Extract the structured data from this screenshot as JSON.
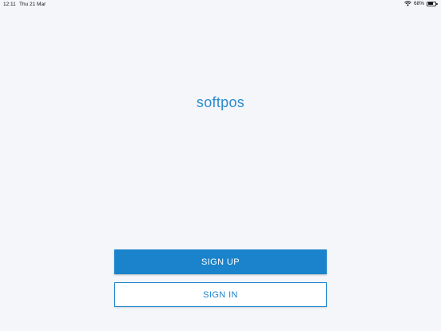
{
  "status_bar": {
    "time": "12:11",
    "date": "Thu 21 Mar",
    "battery_text": "68%",
    "battery_level": 0.68,
    "wifi_icon": "wifi-icon",
    "battery_icon": "battery-icon"
  },
  "logo": {
    "text": "softpos",
    "color": "#2a8ccd"
  },
  "buttons": {
    "sign_up": "SIGN UP",
    "sign_in": "SIGN IN"
  },
  "colors": {
    "primary": "#1a83cb",
    "background": "#f5f6fa"
  }
}
